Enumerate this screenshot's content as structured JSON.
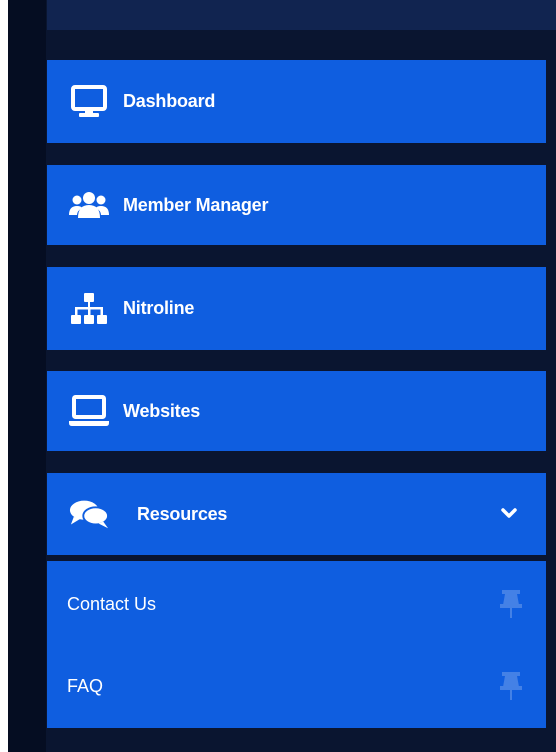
{
  "colors": {
    "sidebar_bg": "#0a1530",
    "item_bg": "#0f5ee0",
    "text": "#ffffff"
  },
  "nav": {
    "items": [
      {
        "label": "Dashboard",
        "icon": "monitor-icon"
      },
      {
        "label": "Member Manager",
        "icon": "users-icon"
      },
      {
        "label": "Nitroline",
        "icon": "sitemap-icon"
      },
      {
        "label": "Websites",
        "icon": "laptop-icon"
      },
      {
        "label": "Resources",
        "icon": "comments-icon",
        "expanded": true
      }
    ],
    "submenu": [
      {
        "label": "Contact Us",
        "icon": "pin-icon"
      },
      {
        "label": "FAQ",
        "icon": "pin-icon"
      }
    ]
  }
}
